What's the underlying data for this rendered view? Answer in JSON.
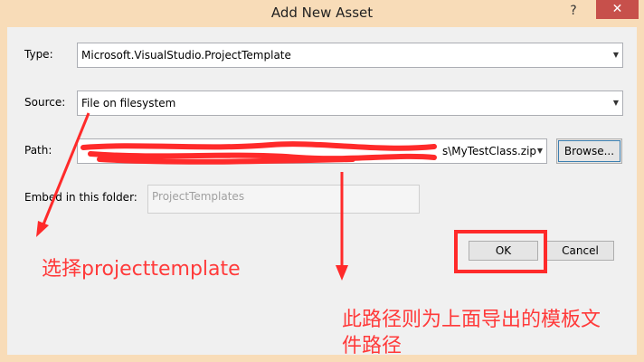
{
  "window": {
    "title": "Add New Asset",
    "help_glyph": "?",
    "close_glyph": "✕"
  },
  "form": {
    "type_label": "Type:",
    "type_value": "Microsoft.VisualStudio.ProjectTemplate",
    "source_label": "Source:",
    "source_value": "File on filesystem",
    "path_label": "Path:",
    "path_value_visible": "s\\MyTestClass.zip",
    "browse_label": "Browse...",
    "embed_label": "Embed in this folder:",
    "embed_value": "ProjectTemplates",
    "ok_label": "OK",
    "cancel_label": "Cancel"
  },
  "annotations": {
    "note1": "选择projecttemplate",
    "note2_line1": "此路径则为上面导出的模板文",
    "note2_line2": "件路径"
  },
  "colors": {
    "frame": "#f8dcb8",
    "close_button": "#c7504b",
    "annotation_red": "#ff2a2a"
  }
}
